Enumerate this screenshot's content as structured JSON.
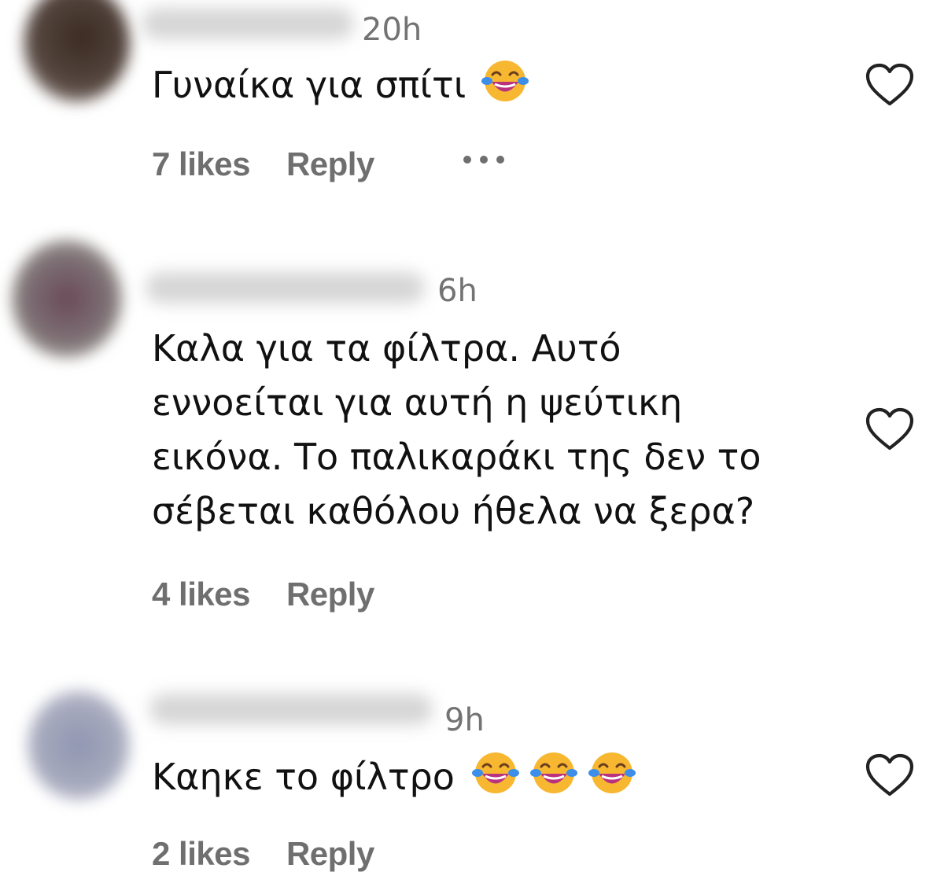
{
  "comments": [
    {
      "timestamp": "20h",
      "text": "Γυναίκα για σπίτι",
      "emoji": "face-with-tears-of-joy",
      "emoji_count": 1,
      "likes": "7 likes",
      "reply": "Reply",
      "has_more_menu": true
    },
    {
      "timestamp": "6h",
      "text": "Καλα για τα φίλτρα. Αυτό\nεννοείται για αυτή η ψεύτικη\nεικόνα. Το παλικαράκι της δεν το\nσέβεται καθόλου ήθελα να ξερα?",
      "emoji_count": 0,
      "likes": "4 likes",
      "reply": "Reply",
      "has_more_menu": false
    },
    {
      "timestamp": "9h",
      "text": "Καηκε το φίλτρο",
      "emoji": "face-with-tears-of-joy",
      "emoji_count": 3,
      "likes": "2 likes",
      "reply": "Reply",
      "has_more_menu": false
    }
  ],
  "icons": {
    "like": "heart-outline-icon",
    "more": "more-options-icon"
  },
  "colors": {
    "text": "#111111",
    "secondary": "#737373",
    "emoji_face": "#f7b731",
    "emoji_tears": "#3d8ee8",
    "emoji_mouth": "#b83280"
  }
}
